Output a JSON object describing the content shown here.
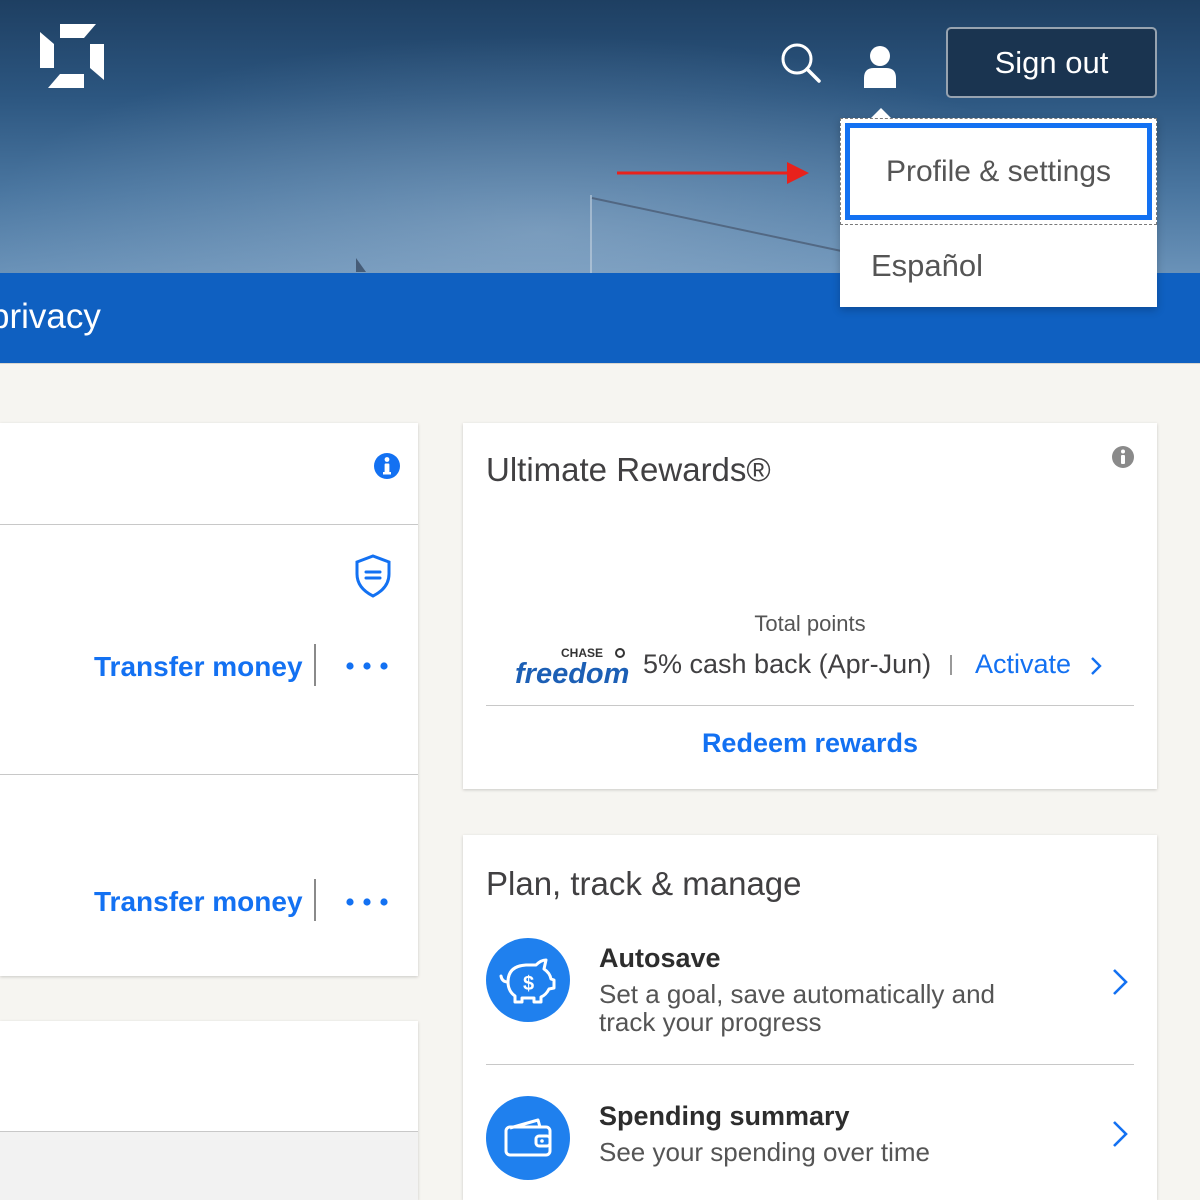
{
  "header": {
    "signout_label": "Sign out",
    "nav_text": "privacy"
  },
  "dropdown": {
    "items": [
      {
        "label": "Profile & settings"
      },
      {
        "label": "Español"
      }
    ]
  },
  "accounts": {
    "rows": [
      {
        "transfer_label": "Transfer money"
      },
      {
        "transfer_label": "Transfer money"
      }
    ]
  },
  "rewards": {
    "title": "Ultimate Rewards®",
    "total_points_label": "Total points",
    "freedom_brand": "CHASE",
    "freedom_name": "freedom",
    "promo_text": "5% cash back (Apr-Jun)",
    "activate_label": "Activate",
    "redeem_label": "Redeem rewards"
  },
  "plan": {
    "title": "Plan, track & manage",
    "features": [
      {
        "title": "Autosave",
        "description": "Set a goal, save automatically and track your progress",
        "icon": "piggy-bank-icon"
      },
      {
        "title": "Spending summary",
        "description": "See your spending over time",
        "icon": "wallet-icon"
      }
    ]
  },
  "colors": {
    "brand_blue": "#0f60c1",
    "link_blue": "#1371f2",
    "focus_ring": "#1371f2",
    "arrow_red": "#e8221c",
    "signout_bg": "#1a3450"
  }
}
